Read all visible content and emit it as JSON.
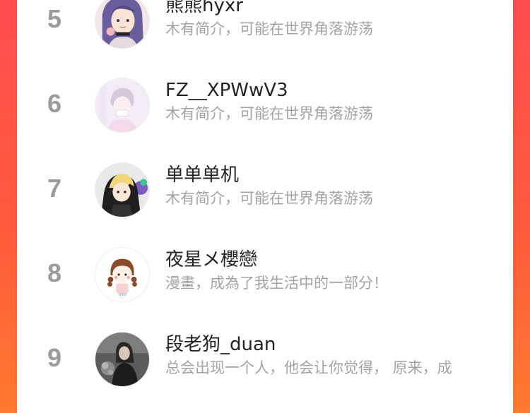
{
  "ranking": {
    "items": [
      {
        "rank": "5",
        "name": "熊熊hyxr",
        "bio": "木有简介，可能在世界角落游荡",
        "avatar_icon": "anime-girl-purple-hair-avatar"
      },
      {
        "rank": "6",
        "name": "FZ__XPWwV3",
        "bio": "木有简介，可能在世界角落游荡",
        "avatar_icon": "pastel-boy-avatar"
      },
      {
        "rank": "7",
        "name": "单单单机",
        "bio": "木有简介，可能在世界角落游荡",
        "avatar_icon": "anime-boy-hoodie-avatar"
      },
      {
        "rank": "8",
        "name": "夜星メ櫻戀",
        "bio": "漫畫，成為了我生活中的一部分！",
        "avatar_icon": "cartoon-girl-braids-avatar"
      },
      {
        "rank": "9",
        "name": "段老狗_duan",
        "bio": "总会出现一个人，他会让你觉得， 原来，成",
        "avatar_icon": "dark-photo-girl-avatar"
      }
    ]
  },
  "colors": {
    "background_gradient_top": "#ff4d4f",
    "background_gradient_bottom": "#ff7a2e",
    "rank": "#9b9b9b",
    "name": "#222222",
    "bio": "#a3a3a3"
  }
}
